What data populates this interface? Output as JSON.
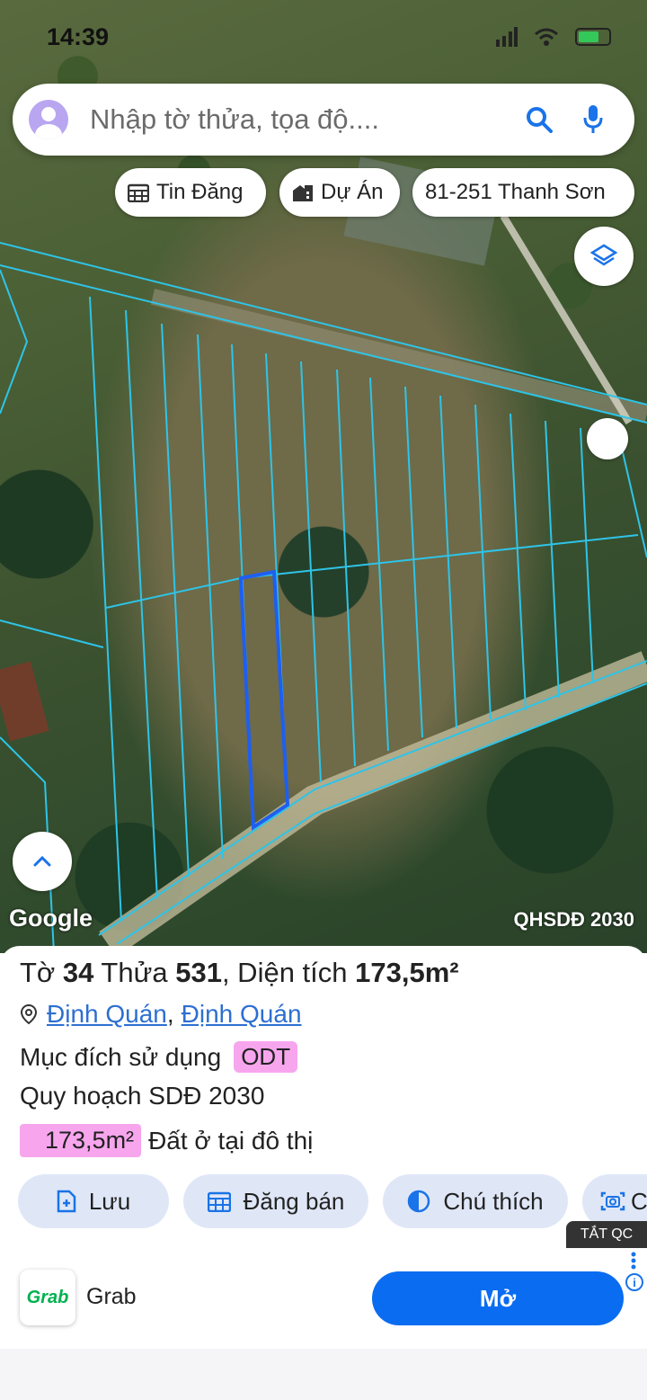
{
  "status_bar": {
    "time": "14:39"
  },
  "search": {
    "placeholder": "Nhập tờ thửa, tọa độ....",
    "icons": [
      "avatar-icon",
      "search-icon",
      "mic-icon"
    ]
  },
  "chips": {
    "listings_label": "Tin Đăng",
    "projects_label": "Dự Án",
    "address_label": "81-251 Thanh Sơn"
  },
  "map": {
    "logo_text": "Google",
    "plan_label": "QHSDĐ 2030",
    "parcel_line_color": "#2ec4e8",
    "selected_parcel_color": "#1e5ff0"
  },
  "parcel": {
    "sheet_prefix": "Tờ ",
    "sheet_no": "34",
    "plot_prefix": " Thửa ",
    "plot_no": "531",
    "area_prefix": ", Diện tích ",
    "area_value": "173,5m²",
    "location_ward": "Định Quán",
    "location_sep": ",",
    "location_district": "Định Quán",
    "purpose_label": "Mục đích sử dụng",
    "purpose_code": "ODT",
    "plan_text": "Quy hoạch SDĐ 2030",
    "zone_area": "173,5m²",
    "zone_desc": "Đất ở tại đô thị",
    "highlight_color": "#f7a6ee"
  },
  "actions": {
    "save": "Lưu",
    "post_sale": "Đăng bán",
    "legend": "Chú thích",
    "screenshot_partial": "C"
  },
  "ad": {
    "close_label": "TẮT QC",
    "brand_logo": "Grab",
    "app_name": "Grab",
    "cta": "Mở",
    "cta_color": "#0a6cf0"
  }
}
